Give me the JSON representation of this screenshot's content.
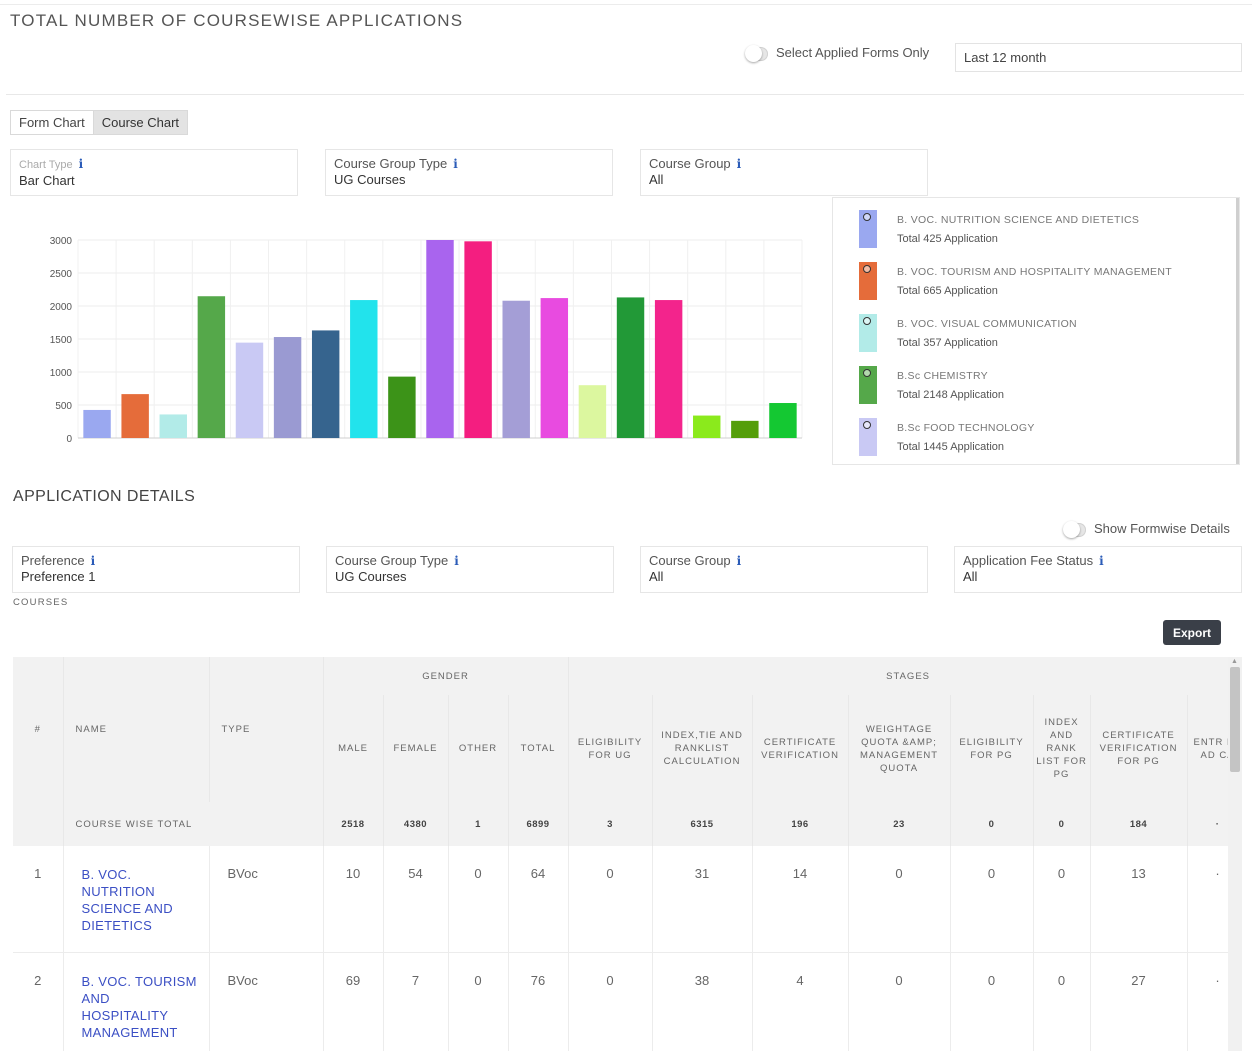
{
  "header": {
    "title": "TOTAL NUMBER OF COURSEWISE APPLICATIONS",
    "applied_toggle_label": "Select Applied Forms Only",
    "period_value": "Last 12 month"
  },
  "tabs": [
    {
      "label": "Form Chart",
      "active": false
    },
    {
      "label": "Course Chart",
      "active": true
    }
  ],
  "chart_filters": {
    "chart_type": {
      "label": "Chart Type",
      "value": "Bar Chart"
    },
    "course_group_type": {
      "label": "Course Group Type",
      "value": "UG Courses"
    },
    "course_group": {
      "label": "Course Group",
      "value": "All"
    }
  },
  "chart_data": {
    "type": "bar",
    "ylim": [
      0,
      3000
    ],
    "yticks": [
      0,
      500,
      1000,
      1500,
      2000,
      2500,
      3000
    ],
    "values": [
      425,
      665,
      357,
      2148,
      1445,
      1530,
      1630,
      2090,
      930,
      3000,
      2980,
      2080,
      2120,
      800,
      2130,
      2090,
      340,
      260,
      530
    ],
    "colors": [
      "#9aa8f0",
      "#e56c3a",
      "#b2ebe8",
      "#55a84a",
      "#c9c9f4",
      "#9a9ad2",
      "#36648e",
      "#22e3ec",
      "#3c9318",
      "#a964ee",
      "#f41e80",
      "#a49ed6",
      "#e84be0",
      "#dcf79f",
      "#229937",
      "#f3248c",
      "#8bea1c",
      "#549e0a",
      "#14c832"
    ],
    "grid": true
  },
  "legend": [
    {
      "name": "B. VOC. NUTRITION SCIENCE AND DIETETICS",
      "total": "Total 425 Application",
      "color": "#9aa8f0"
    },
    {
      "name": "B. VOC. TOURISM AND HOSPITALITY MANAGEMENT",
      "total": "Total 665 Application",
      "color": "#e56c3a"
    },
    {
      "name": "B. VOC. VISUAL COMMUNICATION",
      "total": "Total 357 Application",
      "color": "#b2ebe8"
    },
    {
      "name": "B.Sc CHEMISTRY",
      "total": "Total 2148 Application",
      "color": "#55a84a"
    },
    {
      "name": "B.Sc FOOD TECHNOLOGY",
      "total": "Total 1445 Application",
      "color": "#c9c9f4"
    }
  ],
  "details": {
    "title": "APPLICATION DETAILS",
    "formwise_toggle_label": "Show Formwise Details",
    "preference": {
      "label": "Preference",
      "value": "Preference 1"
    },
    "course_group_type": {
      "label": "Course Group Type",
      "value": "UG Courses"
    },
    "course_group": {
      "label": "Course Group",
      "value": "All"
    },
    "fee_status": {
      "label": "Application Fee Status",
      "value": "All"
    },
    "courses_label": "COURSES",
    "export_label": "Export"
  },
  "table": {
    "group_headers": {
      "gender": "GENDER",
      "stages": "STAGES"
    },
    "columns": {
      "num": "#",
      "name": "NAME",
      "type": "TYPE",
      "male": "MALE",
      "female": "FEMALE",
      "other": "OTHER",
      "total": "TOTAL",
      "elig_ug": "ELIGIBILITY FOR UG",
      "index_tie": "INDEX,TIE AND RANKLIST CALCULATION",
      "cert_ver": "CERTIFICATE VERIFICATION",
      "weightage": "WEIGHTAGE QUOTA &AMP; MANAGEMENT QUOTA",
      "elig_pg": "ELIGIBILITY FOR PG",
      "index_rank_pg": "INDEX AND RANK LIST FOR PG",
      "cert_ver_pg": "CERTIFICATE VERIFICATION FOR PG",
      "entr": "ENTR EX AD CA"
    },
    "total_row": {
      "label": "COURSE WISE TOTAL",
      "male": "2518",
      "female": "4380",
      "other": "1",
      "total": "6899",
      "elig_ug": "3",
      "index_tie": "6315",
      "cert_ver": "196",
      "weightage": "23",
      "elig_pg": "0",
      "index_rank_pg": "0",
      "cert_ver_pg": "184",
      "entr": "·"
    },
    "rows": [
      {
        "num": "1",
        "name": "B. VOC. NUTRITION SCIENCE AND DIETETICS",
        "type": "BVoc",
        "male": "10",
        "female": "54",
        "other": "0",
        "total": "64",
        "elig_ug": "0",
        "index_tie": "31",
        "cert_ver": "14",
        "weightage": "0",
        "elig_pg": "0",
        "index_rank_pg": "0",
        "cert_ver_pg": "13",
        "entr": "·"
      },
      {
        "num": "2",
        "name": "B. VOC. TOURISM AND HOSPITALITY MANAGEMENT",
        "type": "BVoc",
        "male": "69",
        "female": "7",
        "other": "0",
        "total": "76",
        "elig_ug": "0",
        "index_tie": "38",
        "cert_ver": "4",
        "weightage": "0",
        "elig_pg": "0",
        "index_rank_pg": "0",
        "cert_ver_pg": "27",
        "entr": "·"
      }
    ]
  }
}
